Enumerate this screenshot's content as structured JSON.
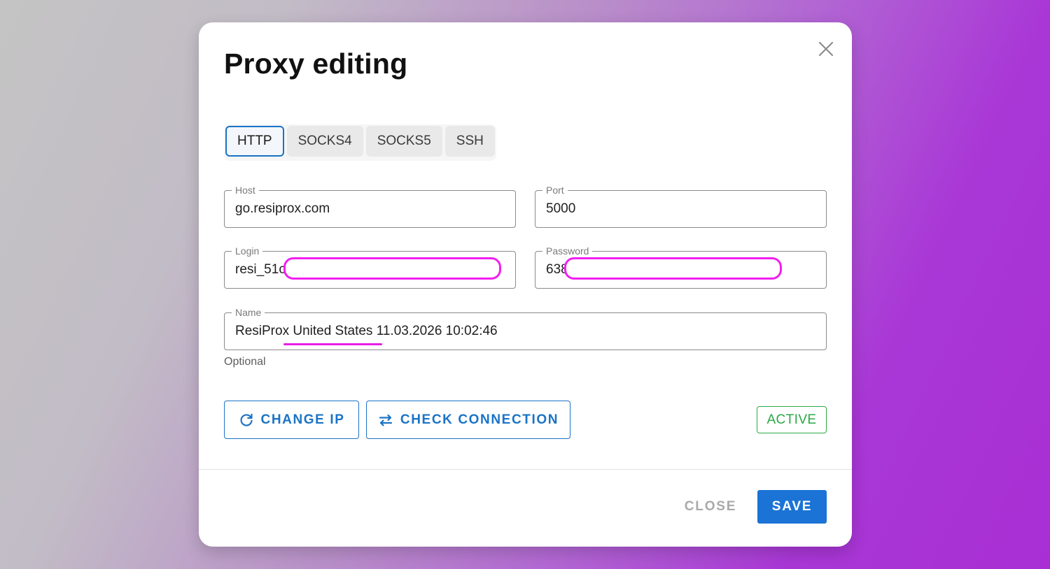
{
  "dialog": {
    "title": "Proxy editing",
    "close_icon": "close-icon"
  },
  "tabs": [
    {
      "label": "HTTP",
      "active": true
    },
    {
      "label": "SOCKS4",
      "active": false
    },
    {
      "label": "SOCKS5",
      "active": false
    },
    {
      "label": "SSH",
      "active": false
    }
  ],
  "fields": {
    "host": {
      "label": "Host",
      "value": "go.resiprox.com"
    },
    "port": {
      "label": "Port",
      "value": "5000"
    },
    "login": {
      "label": "Login",
      "value": "resi_51c"
    },
    "password": {
      "label": "Password",
      "value": "638"
    },
    "name": {
      "label": "Name",
      "value": "ResiProx United States 11.03.2026 10:02:46",
      "helper": "Optional"
    }
  },
  "actions": {
    "change_ip": {
      "label": "CHANGE IP",
      "icon": "refresh-icon"
    },
    "check_connection": {
      "label": "CHECK CONNECTION",
      "icon": "swap-arrows-icon"
    }
  },
  "status": {
    "label": "ACTIVE",
    "color": "#2aa946"
  },
  "footer": {
    "close_label": "CLOSE",
    "save_label": "SAVE"
  },
  "colors": {
    "accent": "#1b73c6",
    "annotation": "#f21ff0",
    "active": "#2aa946"
  }
}
